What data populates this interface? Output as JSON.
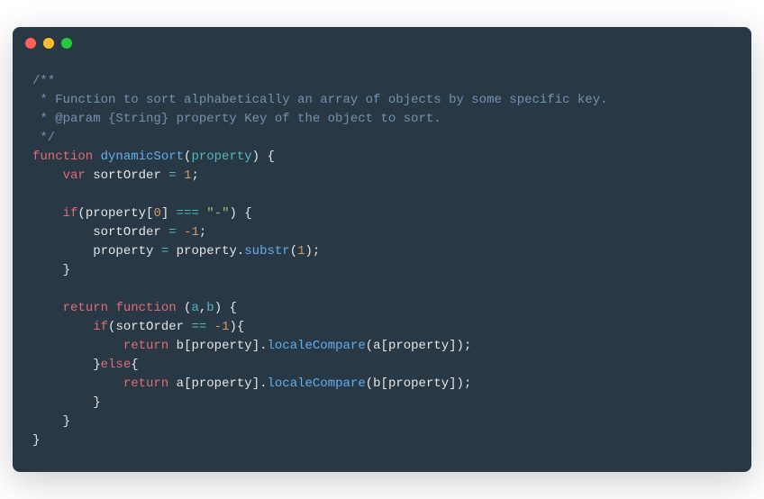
{
  "titlebar": {
    "buttons": [
      "close",
      "minimize",
      "maximize"
    ]
  },
  "code": {
    "lines": [
      {
        "type": "comment",
        "text": "/**"
      },
      {
        "type": "comment",
        "text": " * Function to sort alphabetically an array of objects by some specific key."
      },
      {
        "type": "comment",
        "text": " * @param {String} property Key of the object to sort."
      },
      {
        "type": "comment",
        "text": " */"
      },
      {
        "type": "funcdecl",
        "keyword": "function",
        "name": "dynamicSort",
        "params": "property",
        "open": " {"
      },
      {
        "type": "vardecl",
        "indent": "    ",
        "keyword": "var",
        "name": "sortOrder",
        "op": " = ",
        "value": "1",
        "end": ";"
      },
      {
        "type": "blank",
        "text": ""
      },
      {
        "type": "if1",
        "indent": "    ",
        "keyword": "if",
        "open": "(",
        "var1": "property",
        "bracket1": "[",
        "idx": "0",
        "bracket2": "]",
        "op": " === ",
        "str": "\"-\"",
        "close": ") {"
      },
      {
        "type": "assign",
        "indent": "        ",
        "var": "sortOrder",
        "op": " = ",
        "value": "-1",
        "end": ";"
      },
      {
        "type": "assign2",
        "indent": "        ",
        "var": "property",
        "op": " = ",
        "var2": "property",
        "dot": ".",
        "method": "substr",
        "open": "(",
        "arg": "1",
        "close": ");"
      },
      {
        "type": "close",
        "indent": "    ",
        "text": "}"
      },
      {
        "type": "blank",
        "text": ""
      },
      {
        "type": "retfunc",
        "indent": "    ",
        "keyword1": "return",
        "keyword2": "function",
        "open": " (",
        "p1": "a",
        "comma": ",",
        "p2": "b",
        "close": ") {"
      },
      {
        "type": "if2",
        "indent": "        ",
        "keyword": "if",
        "open": "(",
        "var": "sortOrder",
        "op": " == ",
        "value": "-1",
        "close": "){"
      },
      {
        "type": "retcmp",
        "indent": "            ",
        "keyword": "return",
        "sp": " ",
        "v1": "b",
        "b1": "[",
        "p1": "property",
        "b2": "].",
        "method": "localeCompare",
        "open": "(",
        "v2": "a",
        "b3": "[",
        "p2": "property",
        "b4": "]);"
      },
      {
        "type": "else",
        "indent": "        ",
        "close": "}",
        "keyword": "else",
        "open": "{"
      },
      {
        "type": "retcmp",
        "indent": "            ",
        "keyword": "return",
        "sp": " ",
        "v1": "a",
        "b1": "[",
        "p1": "property",
        "b2": "].",
        "method": "localeCompare",
        "open": "(",
        "v2": "b",
        "b3": "[",
        "p2": "property",
        "b4": "]);"
      },
      {
        "type": "close",
        "indent": "        ",
        "text": "}"
      },
      {
        "type": "close",
        "indent": "    ",
        "text": "}"
      },
      {
        "type": "close",
        "indent": "",
        "text": "}"
      }
    ]
  }
}
